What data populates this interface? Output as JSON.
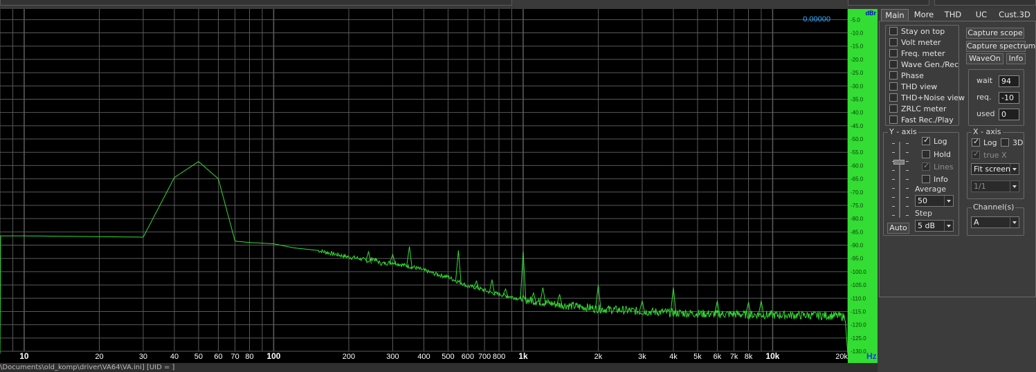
{
  "chart_data": {
    "type": "line",
    "title": "",
    "xlabel": "Hz",
    "ylabel": "dBr",
    "x_scale": "log",
    "xlim": [
      8,
      20000
    ],
    "ylim": [
      -130,
      -1
    ],
    "x_tick_labels": [
      "10",
      "20",
      "30",
      "40",
      "50",
      "60",
      "70",
      "80",
      "100",
      "200",
      "300",
      "400",
      "500",
      "600",
      "700",
      "800",
      "1k",
      "2k",
      "3k",
      "4k",
      "5k",
      "6k",
      "7k",
      "8k",
      "10k",
      "20k"
    ],
    "x_tick_values": [
      10,
      20,
      30,
      40,
      50,
      60,
      70,
      80,
      100,
      200,
      300,
      400,
      500,
      600,
      700,
      800,
      1000,
      2000,
      3000,
      4000,
      5000,
      6000,
      7000,
      8000,
      10000,
      20000
    ],
    "y_ticks": [
      -5,
      -10,
      -15,
      -20,
      -25,
      -30,
      -35,
      -40,
      -45,
      -50,
      -55,
      -60,
      -65,
      -70,
      -75,
      -80,
      -85,
      -90,
      -95,
      -100,
      -105,
      -110,
      -115,
      -120,
      -125,
      -130
    ],
    "y_tick_labels": [
      "-5.0",
      "-10.0",
      "-15.0",
      "-20.0",
      "-25.0",
      "-30.0",
      "-35.0",
      "-40.0",
      "-45.0",
      "-50.0",
      "-55.0",
      "-60.0",
      "-65.0",
      "-70.0",
      "-75.0",
      "-80.0",
      "-85.0",
      "-90.0",
      "-95.0",
      "-100.0",
      "-105.0",
      "-110.0",
      "-115.0",
      "-120.0",
      "-125.0",
      "-130.0"
    ],
    "readout": "0.00000",
    "grid": true,
    "series": [
      {
        "color": "#33dd33",
        "x": [
          8,
          10,
          20,
          30,
          40,
          50,
          60,
          70,
          80,
          100,
          120,
          150,
          200,
          220,
          240,
          250,
          270,
          300,
          330,
          350,
          370,
          400,
          450,
          500,
          540,
          560,
          600,
          650,
          700,
          750,
          800,
          850,
          900,
          950,
          1000,
          1100,
          1200,
          1400,
          1600,
          1800,
          2000,
          2500,
          3000,
          3500,
          4000,
          5000,
          6000,
          7000,
          8000,
          10000,
          12000,
          15000,
          18000,
          19500,
          20000
        ],
        "y": [
          -86.5,
          -86.5,
          -86.8,
          -87.0,
          -64.5,
          -58.5,
          -65.0,
          -88.5,
          -89.0,
          -89.5,
          -91.0,
          -92.0,
          -94.5,
          -95.0,
          -96.0,
          -95.0,
          -97.0,
          -96.5,
          -97.5,
          -98.0,
          -98.5,
          -99.5,
          -101.0,
          -102.0,
          -103.5,
          -104.0,
          -105.5,
          -106.0,
          -107.0,
          -108.0,
          -108.5,
          -109.0,
          -109.5,
          -110.0,
          -110.5,
          -111.0,
          -111.5,
          -112.5,
          -113.0,
          -113.5,
          -114.0,
          -114.5,
          -115.0,
          -115.2,
          -115.5,
          -115.8,
          -116.0,
          -116.0,
          -116.2,
          -116.3,
          -116.4,
          -116.5,
          -116.6,
          -117.0,
          -131.0
        ]
      }
    ],
    "peaks": [
      {
        "x": 240,
        "y": -92.5
      },
      {
        "x": 300,
        "y": -93.5
      },
      {
        "x": 350,
        "y": -90.5
      },
      {
        "x": 550,
        "y": -92.0
      },
      {
        "x": 650,
        "y": -103.5
      },
      {
        "x": 750,
        "y": -103.0
      },
      {
        "x": 850,
        "y": -106.5
      },
      {
        "x": 1000,
        "y": -92.5
      },
      {
        "x": 1100,
        "y": -108.0
      },
      {
        "x": 1200,
        "y": -106.0
      },
      {
        "x": 1400,
        "y": -108.5
      },
      {
        "x": 2000,
        "y": -105.0
      },
      {
        "x": 3000,
        "y": -111.0
      },
      {
        "x": 4000,
        "y": -106.0
      },
      {
        "x": 6000,
        "y": -111.0
      },
      {
        "x": 8000,
        "y": -111.5
      },
      {
        "x": 9000,
        "y": -111.0
      }
    ]
  },
  "status_text": "\\Documents\\old_komp\\driver\\VA64\\VA.ini]  [UID = ]",
  "tabs": [
    "Main",
    "More",
    "THD",
    "UC",
    "Cust.3D"
  ],
  "active_tab": "Main",
  "checkboxes": {
    "stay_on_top": "Stay on top",
    "volt_meter": "Volt meter",
    "freq_meter": "Freq. meter",
    "wave_gen": "Wave Gen./Rec",
    "phase": "Phase",
    "thd_view": "THD view",
    "thd_noise_view": "THD+Noise view",
    "zrlc_meter": "ZRLC meter",
    "fast_rec_play": "Fast Rec./Play"
  },
  "buttons": {
    "capture_scope": "Capture scope",
    "capture_spectrum": "Capture spectrum",
    "wave_on": "WaveOn",
    "info": "Info",
    "auto": "Auto"
  },
  "wait_box": {
    "wait_label": "wait",
    "wait_value": "94",
    "req_label": "req.",
    "req_value": "-10",
    "used_label": "used",
    "used_value": "0"
  },
  "y_axis": {
    "title": "Y - axis",
    "log": "Log",
    "hold": "Hold",
    "lines": "Lines",
    "info": "Info",
    "average_label": "Average",
    "average_value": "50",
    "step_label": "Step",
    "step_value": "5 dB",
    "log_checked": true,
    "hold_checked": false,
    "lines_checked": true,
    "info_checked": false
  },
  "x_axis": {
    "title": "X - axis",
    "log": "Log",
    "three_d": "3D",
    "true_x": "true X",
    "fit": "Fit screen",
    "ratio": "1/1",
    "log_checked": true,
    "three_d_checked": false,
    "true_x_checked": true
  },
  "channels": {
    "title": "Channel(s)",
    "value": "A"
  },
  "colors": {
    "plot_background": "#000000",
    "grid": "#5a5a5a",
    "trace": "#33dd33",
    "scale_bar": "#33dd33",
    "readout": "#33aaff",
    "axis_labels": "#ffffff"
  }
}
